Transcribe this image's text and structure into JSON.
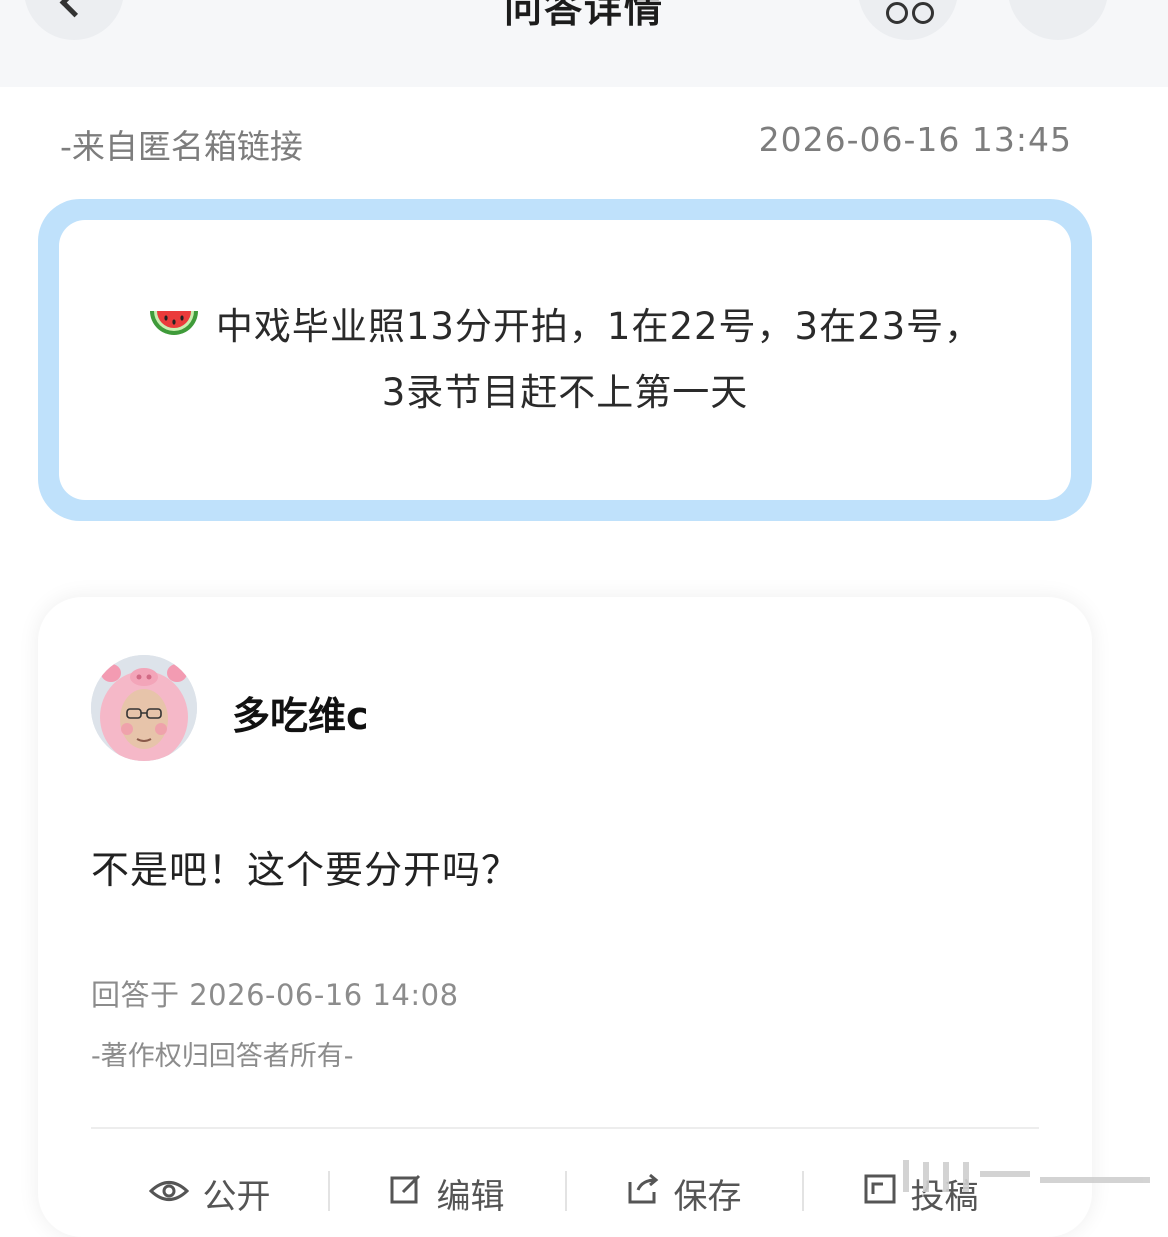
{
  "header": {
    "title": "问答详情"
  },
  "question": {
    "source": "-来自匿名箱链接",
    "time": "2026-06-16 13:45",
    "line1": "中戏毕业照13分开拍，1在22号，3在23号，",
    "line2": "3录节目赶不上第一天"
  },
  "answer": {
    "username": "多吃维c",
    "text": "不是吧！这个要分开吗？",
    "time": "回答于 2026-06-16 14:08",
    "copyright": "-著作权归回答者所有-"
  },
  "actions": [
    {
      "label": "公开",
      "icon": "eye-icon"
    },
    {
      "label": "编辑",
      "icon": "edit-icon"
    },
    {
      "label": "保存",
      "icon": "save-icon"
    },
    {
      "label": "投稿",
      "icon": "submit-icon"
    }
  ],
  "colors": {
    "card_border": "#bfe1fb",
    "header_bg": "#f6f7f9",
    "muted_text": "#7d7d7d"
  }
}
